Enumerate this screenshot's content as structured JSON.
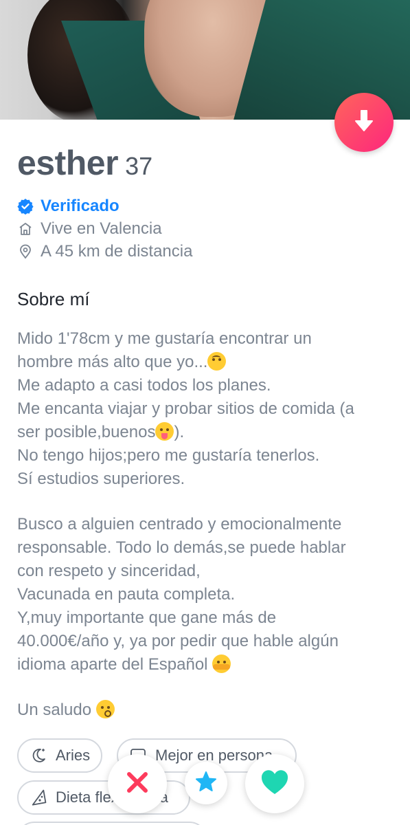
{
  "profile": {
    "name": "esther",
    "age": "37",
    "verified_label": "Verificado",
    "lives_in": "Vive en Valencia",
    "distance": "A 45 km de distancia"
  },
  "about": {
    "title": "Sobre mí",
    "lines": [
      "Mido 1'78cm y me gustaría encontrar un",
      "hombre más alto que yo...",
      "Me adapto a casi todos los planes.",
      "Me encanta viajar y probar sitios de comida (a",
      "ser posible,buenos",
      "No tengo hijos;pero me gustaría tenerlos.",
      "Sí estudios superiores.",
      "Busco a alguien centrado y emocionalmente",
      "responsable. Todo lo demás,se puede hablar",
      "con respeto y sinceridad,",
      "Vacunada en pauta completa.",
      "Y,muy importante que gane más de",
      "40.000€/año y, ya por pedir que hable algún",
      "idioma aparte del  Español",
      "Un saludo"
    ],
    "line5_tail": ")."
  },
  "chips": [
    {
      "label": "Aries",
      "icon": "moon-stars-icon"
    },
    {
      "label": "Mejor en persona",
      "icon": "chat-bubble-icon"
    },
    {
      "label": "Dieta flexitariana",
      "icon": "pizza-slice-icon"
    }
  ],
  "actions": {
    "nope": "close-icon",
    "super_like": "star-icon",
    "like": "heart-icon"
  },
  "colors": {
    "brand_gradient_start": "#ff655b",
    "brand_gradient_end": "#fd267d",
    "verified_blue": "#1786ff",
    "nope_red": "#fd3b5c",
    "star_blue": "#20b6f5",
    "like_green": "#1ed6b2"
  }
}
